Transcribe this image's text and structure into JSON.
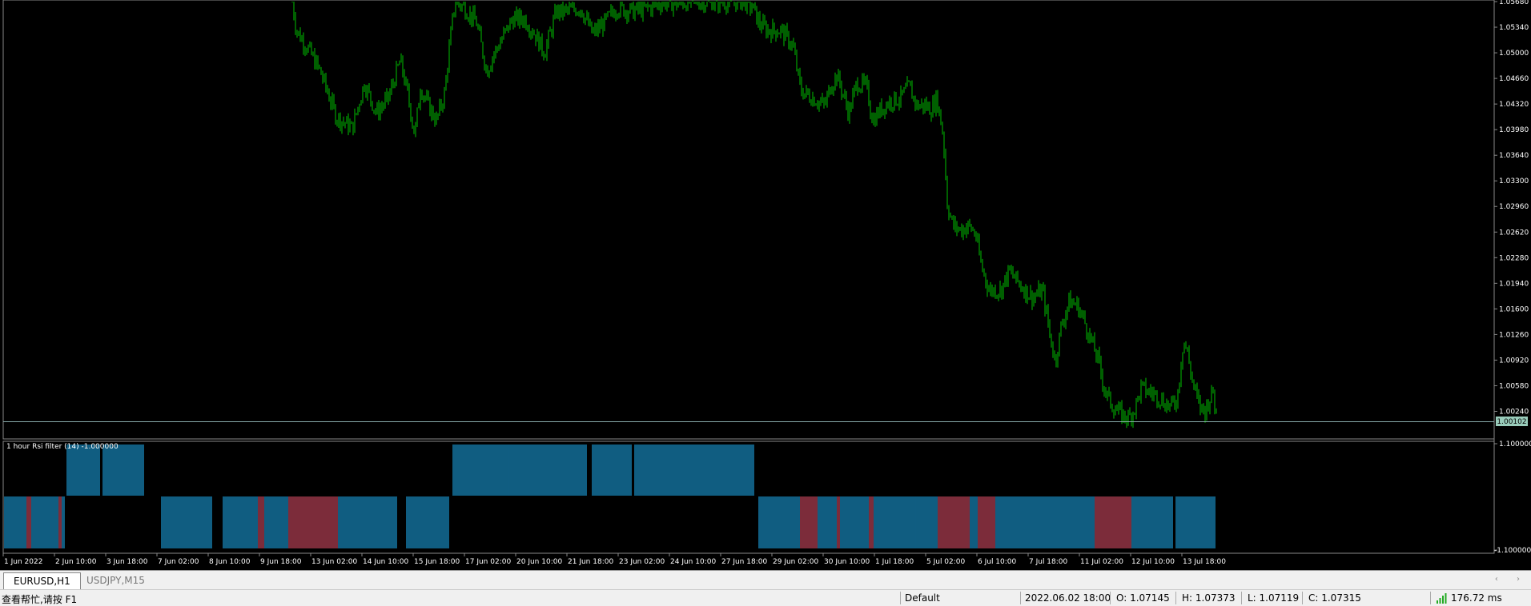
{
  "colors": {
    "candle": "#00c000",
    "ind_blue": "#1a8fc7",
    "ind_red": "#c0435a",
    "grid": "#9ab"
  },
  "price_axis": {
    "labels": [
      "1.05680",
      "1.05340",
      "1.05000",
      "1.04660",
      "1.04320",
      "1.03980",
      "1.03640",
      "1.03300",
      "1.02960",
      "1.02620",
      "1.02280",
      "1.01940",
      "1.01600",
      "1.01260",
      "1.00920",
      "1.00580",
      "1.00240"
    ],
    "current": "1.00102"
  },
  "indicator": {
    "title": "1 hour Rsi filter (14) -1.000000",
    "axis_top": "1.100000",
    "axis_bottom": "-1.100000"
  },
  "time_axis": [
    "1 Jun 2022",
    "2 Jun 10:00",
    "3 Jun 18:00",
    "7 Jun 02:00",
    "8 Jun 10:00",
    "9 Jun 18:00",
    "13 Jun 02:00",
    "14 Jun 10:00",
    "15 Jun 18:00",
    "17 Jun 02:00",
    "20 Jun 10:00",
    "21 Jun 18:00",
    "23 Jun 02:00",
    "24 Jun 10:00",
    "27 Jun 18:00",
    "29 Jun 02:00",
    "30 Jun 10:00",
    "1 Jul 18:00",
    "5 Jul 02:00",
    "6 Jul 10:00",
    "7 Jul 18:00",
    "11 Jul 02:00",
    "12 Jul 10:00",
    "13 Jul 18:00"
  ],
  "tabs": [
    {
      "label": "EURUSD,H1",
      "active": true
    },
    {
      "label": "USDJPY,M15",
      "active": false
    }
  ],
  "status": {
    "help": "查看帮忙,请按 F1",
    "profile": "Default",
    "datetime": "2022.06.02 18:00",
    "open": "O: 1.07145",
    "high": "H: 1.07373",
    "low": "L: 1.07119",
    "close": "C: 1.07315",
    "ping": "176.72 ms"
  },
  "chart_data": {
    "type": "candlestick",
    "symbol": "EURUSD",
    "timeframe": "H1",
    "ylim": [
      1.00102,
      1.0568
    ],
    "price_points": [
      [
        365,
        1.0568
      ],
      [
        370,
        1.053
      ],
      [
        385,
        1.0505
      ],
      [
        400,
        1.0475
      ],
      [
        420,
        1.0415
      ],
      [
        440,
        1.04
      ],
      [
        455,
        1.046
      ],
      [
        470,
        1.042
      ],
      [
        485,
        1.044
      ],
      [
        500,
        1.049
      ],
      [
        510,
        1.044
      ],
      [
        518,
        1.039
      ],
      [
        525,
        1.0455
      ],
      [
        535,
        1.043
      ],
      [
        545,
        1.041
      ],
      [
        555,
        1.0445
      ],
      [
        562,
        1.0515
      ],
      [
        568,
        1.0568
      ],
      [
        580,
        1.056
      ],
      [
        595,
        1.054
      ],
      [
        608,
        1.0475
      ],
      [
        615,
        1.0495
      ],
      [
        625,
        1.0515
      ],
      [
        640,
        1.0545
      ],
      [
        655,
        1.0545
      ],
      [
        668,
        1.0525
      ],
      [
        680,
        1.05
      ],
      [
        695,
        1.0555
      ],
      [
        708,
        1.0555
      ],
      [
        725,
        1.056
      ],
      [
        740,
        1.0525
      ],
      [
        755,
        1.054
      ],
      [
        770,
        1.056
      ],
      [
        790,
        1.0555
      ],
      [
        810,
        1.056
      ],
      [
        830,
        1.0568
      ],
      [
        845,
        1.0565
      ],
      [
        860,
        1.0568
      ],
      [
        880,
        1.0568
      ],
      [
        900,
        1.0568
      ],
      [
        915,
        1.0568
      ],
      [
        930,
        1.0568
      ],
      [
        940,
        1.056
      ],
      [
        948,
        1.054
      ],
      [
        958,
        1.053
      ],
      [
        975,
        1.053
      ],
      [
        990,
        1.051
      ],
      [
        1000,
        1.045
      ],
      [
        1015,
        1.044
      ],
      [
        1030,
        1.043
      ],
      [
        1037,
        1.0455
      ],
      [
        1045,
        1.047
      ],
      [
        1050,
        1.0455
      ],
      [
        1060,
        1.042
      ],
      [
        1070,
        1.046
      ],
      [
        1082,
        1.0455
      ],
      [
        1090,
        1.041
      ],
      [
        1100,
        1.0425
      ],
      [
        1110,
        1.0435
      ],
      [
        1125,
        1.044
      ],
      [
        1135,
        1.0455
      ],
      [
        1145,
        1.043
      ],
      [
        1155,
        1.043
      ],
      [
        1163,
        1.0425
      ],
      [
        1170,
        1.044
      ],
      [
        1178,
        1.039
      ],
      [
        1183,
        1.03
      ],
      [
        1190,
        1.027
      ],
      [
        1200,
        1.0265
      ],
      [
        1210,
        1.027
      ],
      [
        1218,
        1.026
      ],
      [
        1225,
        1.022
      ],
      [
        1235,
        1.0185
      ],
      [
        1250,
        1.0185
      ],
      [
        1260,
        1.021
      ],
      [
        1268,
        1.02
      ],
      [
        1280,
        1.0185
      ],
      [
        1290,
        1.0175
      ],
      [
        1302,
        1.0185
      ],
      [
        1312,
        1.012
      ],
      [
        1318,
        1.009
      ],
      [
        1325,
        1.0135
      ],
      [
        1335,
        1.017
      ],
      [
        1345,
        1.0165
      ],
      [
        1352,
        1.015
      ],
      [
        1362,
        1.012
      ],
      [
        1372,
        1.009
      ],
      [
        1380,
        1.005
      ],
      [
        1390,
        1.003
      ],
      [
        1400,
        1.002
      ],
      [
        1410,
        1.0015
      ],
      [
        1418,
        1.003
      ],
      [
        1425,
        1.0055
      ],
      [
        1435,
        1.005
      ],
      [
        1445,
        1.0045
      ],
      [
        1455,
        1.0035
      ],
      [
        1462,
        1.003
      ],
      [
        1470,
        1.004
      ],
      [
        1478,
        1.012
      ],
      [
        1482,
        1.0105
      ],
      [
        1490,
        1.006
      ],
      [
        1498,
        1.003
      ],
      [
        1505,
        1.0025
      ],
      [
        1510,
        1.004
      ],
      [
        1515,
        1.005
      ],
      [
        1520,
        1.001
      ]
    ]
  }
}
